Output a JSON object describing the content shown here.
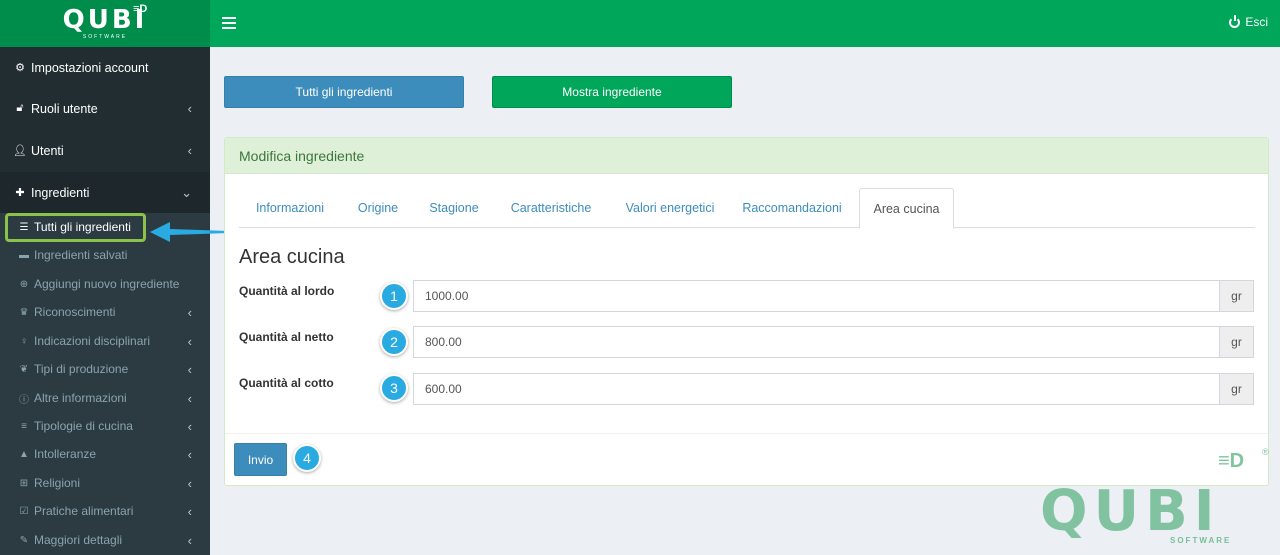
{
  "brand": {
    "logo": "QUBI",
    "logo_sub": "SOFTWARE",
    "logo_mark": "≡D"
  },
  "header": {
    "logout_label": "Esci"
  },
  "sidebar": {
    "items": [
      {
        "label": "Impostazioni account",
        "icon": "gear-icon"
      },
      {
        "label": "Ruoli utente",
        "icon": "unlock-icon",
        "chevron": "‹"
      },
      {
        "label": "Utenti",
        "icon": "user-icon",
        "chevron": "‹"
      },
      {
        "label": "Ingredienti",
        "icon": "puzzle-icon",
        "chevron": "⌄"
      }
    ],
    "submenu": [
      {
        "label": "Tutti gli ingredienti",
        "icon": "list-icon",
        "current": true
      },
      {
        "label": "Ingredienti salvati",
        "icon": "archive-icon"
      },
      {
        "label": "Aggiungi nuovo ingrediente",
        "icon": "plus-circle-icon"
      },
      {
        "label": "Riconoscimenti",
        "icon": "trophy-icon",
        "chevron": "‹"
      },
      {
        "label": "Indicazioni disciplinari",
        "icon": "lightbulb-icon",
        "chevron": "‹"
      },
      {
        "label": "Tipi di produzione",
        "icon": "leaf-icon",
        "chevron": "‹"
      },
      {
        "label": "Altre informazioni",
        "icon": "info-icon",
        "chevron": "‹"
      },
      {
        "label": "Tipologie di cucina",
        "icon": "align-left-icon",
        "chevron": "‹"
      },
      {
        "label": "Intolleranze",
        "icon": "warning-icon",
        "chevron": "‹"
      },
      {
        "label": "Religioni",
        "icon": "plus-square-icon",
        "chevron": "‹"
      },
      {
        "label": "Pratiche alimentari",
        "icon": "check-square-icon",
        "chevron": "‹"
      },
      {
        "label": "Maggiori dettagli",
        "icon": "wrench-icon",
        "chevron": "‹"
      }
    ]
  },
  "actions": {
    "all_ingredients": "Tutti gli ingredienti",
    "show_ingredient": "Mostra ingrediente"
  },
  "panel": {
    "title": "Modifica ingrediente",
    "tabs": [
      "Informazioni",
      "Origine",
      "Stagione",
      "Caratteristiche",
      "Valori energetici",
      "Raccomandazioni",
      "Area cucina"
    ],
    "active_tab": "Area cucina",
    "section_title": "Area cucina",
    "fields": [
      {
        "label": "Quantità al lordo",
        "value": "1000.00",
        "unit": "gr",
        "badge": "1"
      },
      {
        "label": "Quantità al netto",
        "value": "800.00",
        "unit": "gr",
        "badge": "2"
      },
      {
        "label": "Quantità al cotto",
        "value": "600.00",
        "unit": "gr",
        "badge": "3"
      }
    ],
    "submit_label": "Invio",
    "submit_badge": "4"
  },
  "watermark": {
    "text": "QUBI",
    "sub": "SOFTWARE",
    "mark": "≡D",
    "reg": "®"
  },
  "colors": {
    "header": "#00a65a",
    "sidebar": "#222d32",
    "primary": "#3c8dbc",
    "success": "#00a65a",
    "badge": "#29abe2",
    "highlight": "#8bc34a"
  }
}
